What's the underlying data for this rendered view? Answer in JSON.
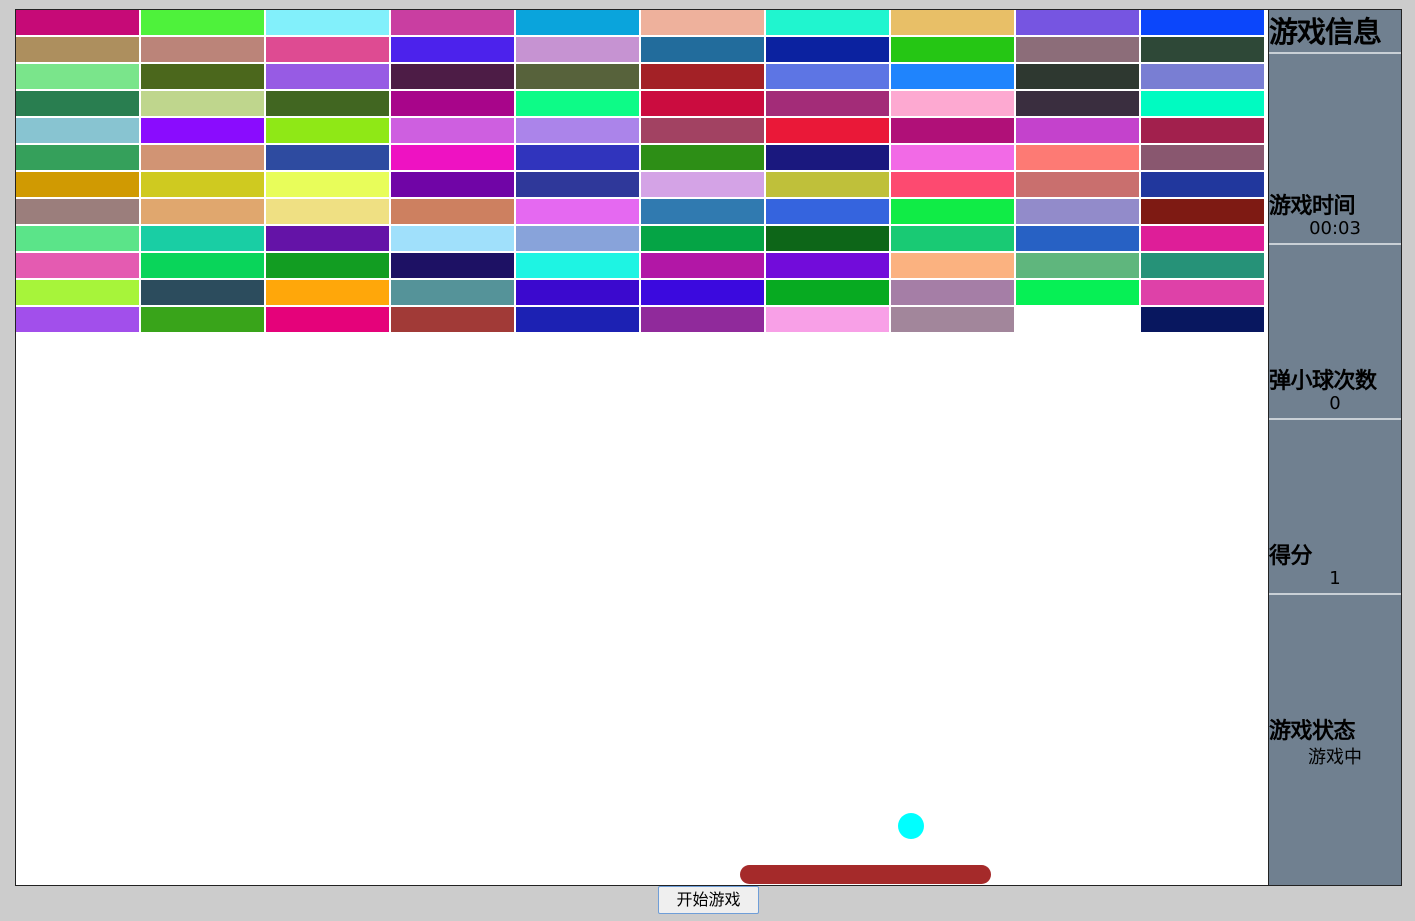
{
  "bricks": {
    "rows": [
      [
        "#c60a77",
        "#4ef23b",
        "#82f0fb",
        "#c93ea1",
        "#0aa4dc",
        "#eeb19c",
        "#20f5cf",
        "#e8bf67",
        "#7655e1",
        "#0b46fb"
      ],
      [
        "#ad8f5e",
        "#bb8479",
        "#de4b92",
        "#4c22ec",
        "#c693d2",
        "#226c9c",
        "#0b22a0",
        "#25c614",
        "#8c6d79",
        "#2e4837"
      ],
      [
        "#7ae58b",
        "#4b671c",
        "#975be4",
        "#4d1c46",
        "#57623b",
        "#a32126",
        "#5d75e4",
        "#1f84fd",
        "#2e3830",
        "#797ed3"
      ],
      [
        "#297e50",
        "#bfd68d",
        "#416621",
        "#a8058a",
        "#0dfb87",
        "#cb0c3f",
        "#a32c78",
        "#fda9d1",
        "#3a2e3f",
        "#00fbc1"
      ],
      [
        "#88c4d1",
        "#8a0cfe",
        "#8fe816",
        "#ce5fe0",
        "#ab84ea",
        "#a24262",
        "#ea1838",
        "#b01078",
        "#c442cc",
        "#a2204d"
      ],
      [
        "#35a05b",
        "#d19474",
        "#2e4ba0",
        "#ee12c2",
        "#3034bd",
        "#2d8e16",
        "#1a187e",
        "#f26ae6",
        "#fd7a74",
        "#89576f"
      ],
      [
        "#d09a02",
        "#cfca20",
        "#e8fd5a",
        "#7005a6",
        "#2f389a",
        "#d4a3e6",
        "#bfc03a",
        "#fd4a70",
        "#c96f6e",
        "#21379d"
      ],
      [
        "#9b7e7c",
        "#e0a76e",
        "#efe083",
        "#cd8060",
        "#e569f1",
        "#307ab0",
        "#3564de",
        "#10ec46",
        "#928bca",
        "#7e1a13"
      ],
      [
        "#5be489",
        "#19cea4",
        "#6413a7",
        "#a0e0fb",
        "#88a3da",
        "#05a445",
        "#0d6618",
        "#19ca74",
        "#2761c4",
        "#de1e98"
      ],
      [
        "#e45bb1",
        "#09d55a",
        "#129d22",
        "#1d1164",
        "#1ef4e3",
        "#b217a6",
        "#720cda",
        "#fbb280",
        "#5fb67d",
        "#269278"
      ],
      [
        "#a7f43a",
        "#2c4c5d",
        "#ffa70a",
        "#559399",
        "#3b09ce",
        "#3b09de",
        "#07aa21",
        "#a57ea6",
        "#06f055",
        "#de41a8"
      ],
      [
        "#a24feb",
        "#39a41a",
        "#e5027a",
        "#a13a37",
        "#1c21b3",
        "#902a9b",
        "#f8a0e7",
        "#a2869b",
        "",
        "#08175f"
      ]
    ]
  },
  "ball": {
    "color": "#00ffff"
  },
  "paddle": {
    "color": "#a52a2a"
  },
  "info_panel": {
    "title": "游戏信息",
    "time_label": "游戏时间",
    "time_value": "00:03",
    "bounces_label": "弹小球次数",
    "bounces_value": "0",
    "score_label": "得分",
    "score_value": "1",
    "status_label": "游戏状态",
    "status_value": "游戏中"
  },
  "start_button": {
    "label": "开始游戏"
  }
}
